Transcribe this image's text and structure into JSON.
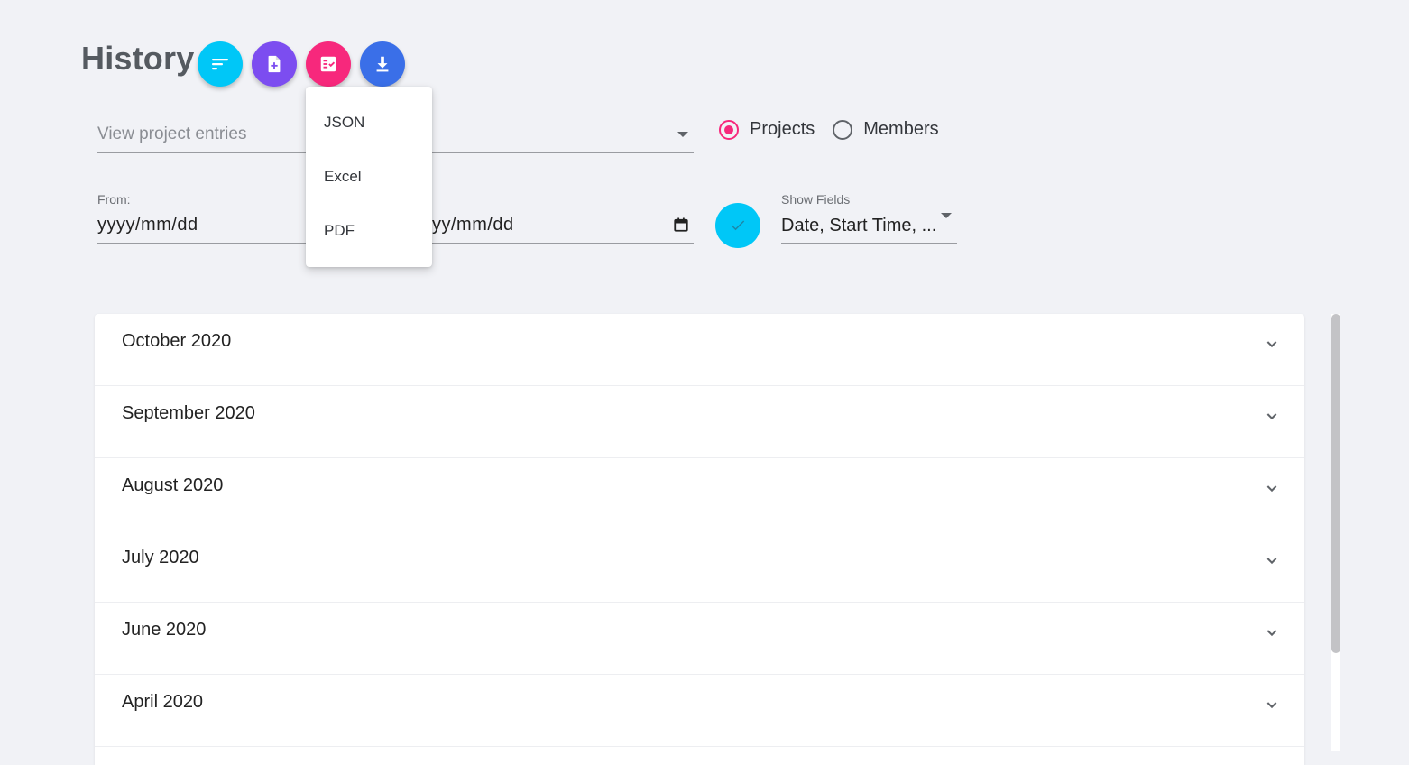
{
  "header": {
    "title": "History"
  },
  "fabs": {
    "sort": {
      "icon": "sort-icon",
      "color": "#00c7f7"
    },
    "add": {
      "icon": "add-document-icon",
      "color": "#7c4df0"
    },
    "report": {
      "icon": "report-icon",
      "color": "#f7287c"
    },
    "download": {
      "icon": "download-icon",
      "color": "#3a6fe8"
    }
  },
  "export_menu": {
    "items": [
      "JSON",
      "Excel",
      "PDF"
    ]
  },
  "filters": {
    "entries_placeholder": "View project entries",
    "radio_projects": "Projects",
    "radio_members": "Members",
    "radio_selected": "Projects",
    "from_label": "From:",
    "from_value": "yyyy/mm/dd",
    "to_value": "yyyy/mm/dd",
    "show_fields_label": "Show Fields",
    "show_fields_value": "Date, Start Time, ..."
  },
  "months": [
    "October 2020",
    "September 2020",
    "August 2020",
    "July 2020",
    "June 2020",
    "April 2020"
  ],
  "colors": {
    "accent_pink": "#f7287c",
    "accent_cyan": "#00c7f7",
    "background": "#f1f2f6"
  }
}
